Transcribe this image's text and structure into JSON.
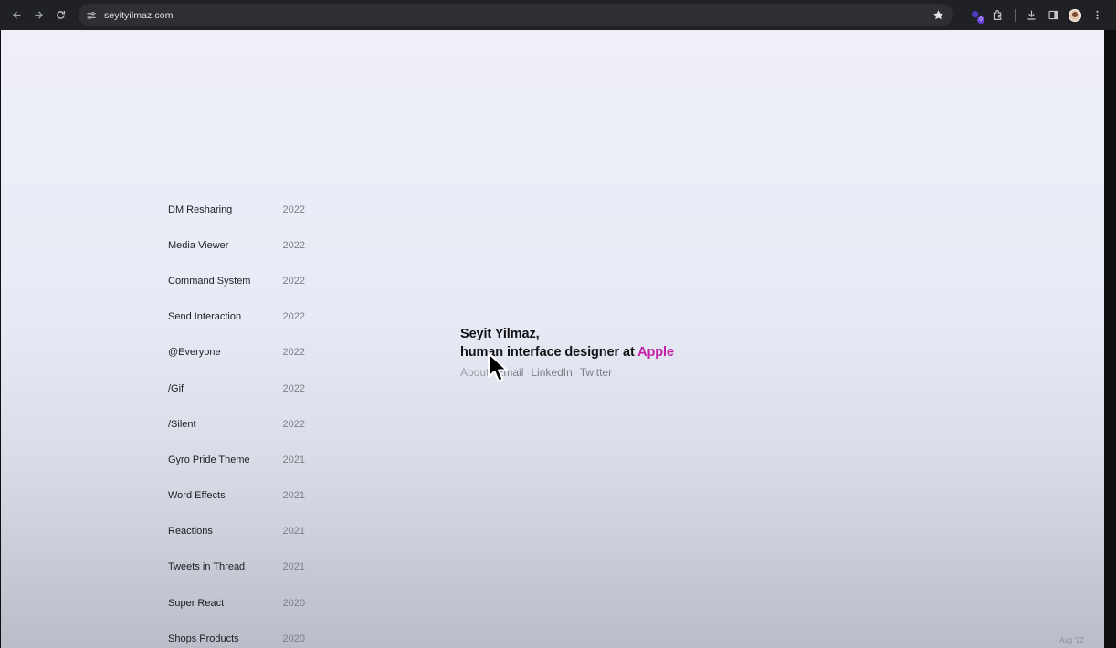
{
  "browser": {
    "url": "seyityilmaz.com",
    "extension_badge": "0"
  },
  "projects": [
    {
      "name": "DM Resharing",
      "year": "2022"
    },
    {
      "name": "Media Viewer",
      "year": "2022"
    },
    {
      "name": "Command System",
      "year": "2022"
    },
    {
      "name": "Send Interaction",
      "year": "2022"
    },
    {
      "name": "@Everyone",
      "year": "2022"
    },
    {
      "name": "/Gif",
      "year": "2022"
    },
    {
      "name": "/Silent",
      "year": "2022"
    },
    {
      "name": "Gyro Pride Theme",
      "year": "2021"
    },
    {
      "name": "Word Effects",
      "year": "2021"
    },
    {
      "name": "Reactions",
      "year": "2021"
    },
    {
      "name": "Tweets in Thread",
      "year": "2021"
    },
    {
      "name": "Super React",
      "year": "2020"
    },
    {
      "name": "Shops Products",
      "year": "2020"
    }
  ],
  "intro": {
    "name_line": "Seyit Yilmaz,",
    "role_prefix": "human interface designer at ",
    "company": "Apple",
    "accent_color": "#c31ea6"
  },
  "links": {
    "about": "About",
    "email": "Email",
    "linkedin": "LinkedIn",
    "twitter": "Twitter"
  },
  "footer": {
    "date": "Aug '22"
  }
}
